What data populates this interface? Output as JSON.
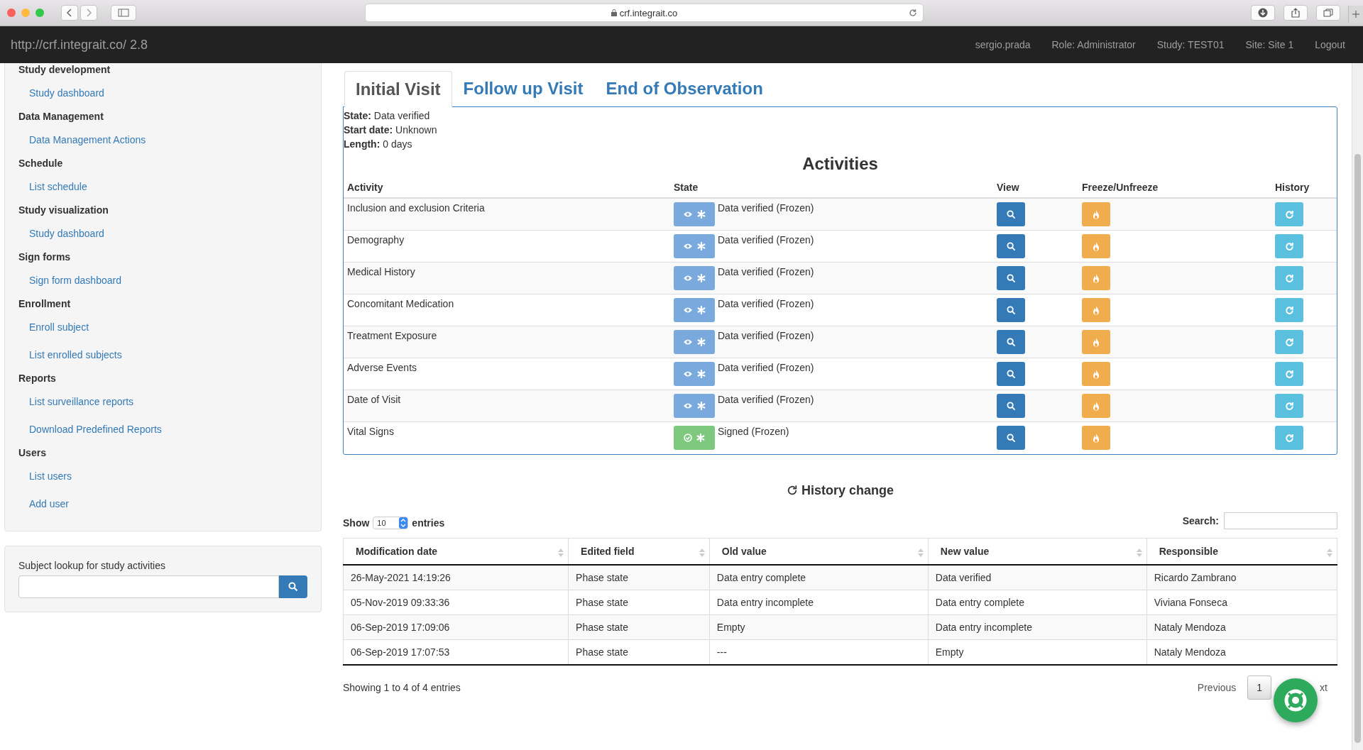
{
  "browser": {
    "url": "crf.integrait.co"
  },
  "navbar": {
    "brand": "http://crf.integrait.co/ 2.8",
    "items": [
      "sergio.prada",
      "Role: Administrator",
      "Study: TEST01",
      "Site: Site 1",
      "Logout"
    ]
  },
  "sidebar": {
    "sections": [
      {
        "title": "Study development",
        "links": [
          "Study dashboard"
        ]
      },
      {
        "title": "Data Management",
        "links": [
          "Data Management Actions"
        ]
      },
      {
        "title": "Schedule",
        "links": [
          "List schedule"
        ]
      },
      {
        "title": "Study visualization",
        "links": [
          "Study dashboard"
        ]
      },
      {
        "title": "Sign forms",
        "links": [
          "Sign form dashboard"
        ]
      },
      {
        "title": "Enrollment",
        "links": [
          "Enroll subject",
          "List enrolled subjects"
        ]
      },
      {
        "title": "Reports",
        "links": [
          "List surveillance reports",
          "Download Predefined Reports"
        ]
      },
      {
        "title": "Users",
        "links": [
          "List users",
          "Add user"
        ]
      }
    ],
    "lookup": {
      "label": "Subject lookup for study activities"
    }
  },
  "tabs": [
    {
      "label": "Initial Visit",
      "selected": true
    },
    {
      "label": "Follow up Visit",
      "selected": false
    },
    {
      "label": "End of Observation",
      "selected": false
    }
  ],
  "info": [
    {
      "label": "State:",
      "value": "Data verified"
    },
    {
      "label": "Start date:",
      "value": "Unknown"
    },
    {
      "label": "Length:",
      "value": "0 days"
    }
  ],
  "activities": {
    "title": "Activities",
    "columns": [
      "Activity",
      "State",
      "View",
      "Freeze/Unfreeze",
      "History"
    ],
    "rows": [
      {
        "activity": "Inclusion and exclusion Criteria",
        "kind": "verified",
        "state": "Data verified (Frozen)"
      },
      {
        "activity": "Demography",
        "kind": "verified",
        "state": "Data verified (Frozen)"
      },
      {
        "activity": "Medical History",
        "kind": "verified",
        "state": "Data verified (Frozen)"
      },
      {
        "activity": "Concomitant Medication",
        "kind": "verified",
        "state": "Data verified (Frozen)"
      },
      {
        "activity": "Treatment Exposure",
        "kind": "verified",
        "state": "Data verified (Frozen)"
      },
      {
        "activity": "Adverse Events",
        "kind": "verified",
        "state": "Data verified (Frozen)"
      },
      {
        "activity": "Date of Visit",
        "kind": "verified",
        "state": "Data verified (Frozen)"
      },
      {
        "activity": "Vital Signs",
        "kind": "signed",
        "state": "Signed (Frozen)"
      }
    ]
  },
  "history": {
    "title": "History change",
    "show_label": "Show",
    "page_size": "10",
    "entries_label": "entries",
    "search_label": "Search:",
    "columns": [
      "Modification date",
      "Edited field",
      "Old value",
      "New value",
      "Responsible"
    ],
    "rows": [
      [
        "26-May-2021 14:19:26",
        "Phase state",
        "Data entry complete",
        "Data verified",
        "Ricardo Zambrano"
      ],
      [
        "05-Nov-2019 09:33:36",
        "Phase state",
        "Data entry incomplete",
        "Data entry complete",
        "Viviana Fonseca"
      ],
      [
        "06-Sep-2019 17:09:06",
        "Phase state",
        "Empty",
        "Data entry incomplete",
        "Nataly Mendoza"
      ],
      [
        "06-Sep-2019 17:07:53",
        "Phase state",
        "---",
        "Empty",
        "Nataly Mendoza"
      ]
    ],
    "summary": "Showing 1 to 4 of 4 entries",
    "previous": "Previous",
    "page": "1",
    "next": "xt"
  }
}
